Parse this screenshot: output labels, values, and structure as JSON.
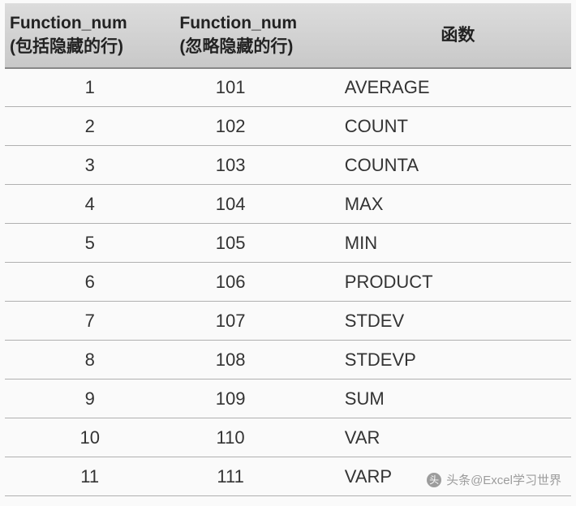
{
  "table": {
    "headers": {
      "col1_line1": "Function_num",
      "col1_line2": "(包括隐藏的行)",
      "col2_line1": "Function_num",
      "col2_line2": "(忽略隐藏的行)",
      "col3": "函数"
    },
    "rows": [
      {
        "num_include": "1",
        "num_ignore": "101",
        "func": "AVERAGE"
      },
      {
        "num_include": "2",
        "num_ignore": "102",
        "func": "COUNT"
      },
      {
        "num_include": "3",
        "num_ignore": "103",
        "func": "COUNTA"
      },
      {
        "num_include": "4",
        "num_ignore": "104",
        "func": "MAX"
      },
      {
        "num_include": "5",
        "num_ignore": "105",
        "func": "MIN"
      },
      {
        "num_include": "6",
        "num_ignore": "106",
        "func": "PRODUCT"
      },
      {
        "num_include": "7",
        "num_ignore": "107",
        "func": "STDEV"
      },
      {
        "num_include": "8",
        "num_ignore": "108",
        "func": "STDEVP"
      },
      {
        "num_include": "9",
        "num_ignore": "109",
        "func": "SUM"
      },
      {
        "num_include": "10",
        "num_ignore": "110",
        "func": "VAR"
      },
      {
        "num_include": "11",
        "num_ignore": "111",
        "func": "VARP"
      }
    ]
  },
  "watermark": {
    "text": "头条@Excel学习世界"
  }
}
